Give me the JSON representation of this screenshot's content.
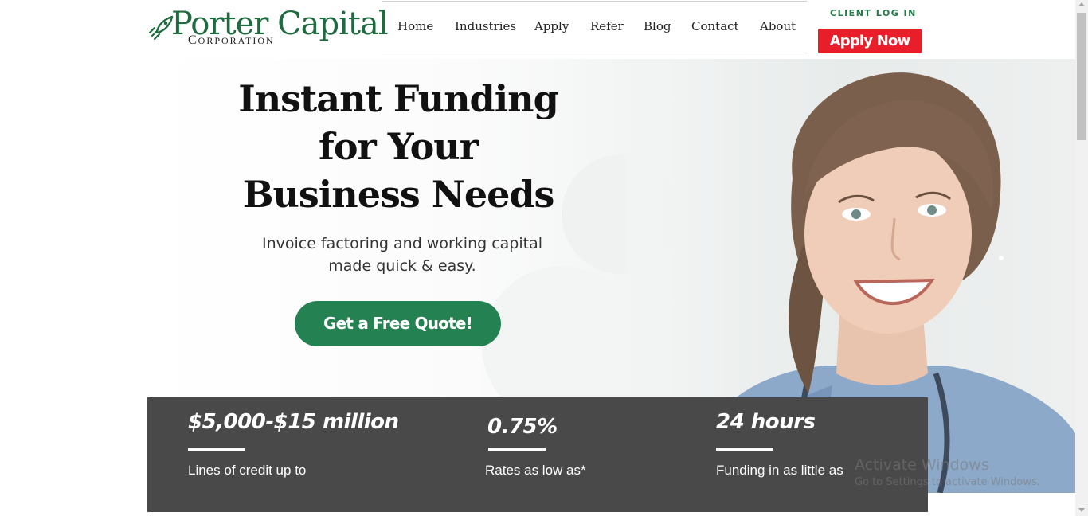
{
  "brand": {
    "name": "Porter Capital",
    "sub": "Corporation",
    "color": "#1f6b3f",
    "icon": "rocket-icon"
  },
  "nav": {
    "items": [
      "Home",
      "Industries",
      "Apply",
      "Refer",
      "Blog",
      "Contact",
      "About"
    ]
  },
  "header": {
    "client_login": "CLIENT LOG IN",
    "apply_now": "Apply Now",
    "apply_color": "#e81f2a"
  },
  "hero": {
    "headline": "Instant Funding for Your Business Needs",
    "tagline": "Invoice factoring and working capital made quick & easy.",
    "cta": "Get a Free Quote!",
    "cta_color": "#238152"
  },
  "stats": [
    {
      "value": "$5,000-$15 million",
      "label": "Lines of credit up to"
    },
    {
      "value": "0.75%",
      "label": "Rates as low as*"
    },
    {
      "value": "24 hours",
      "label": "Funding in as little as"
    }
  ],
  "watermark": {
    "title": "Activate Windows",
    "subtitle": "Go to Settings to activate Windows."
  }
}
